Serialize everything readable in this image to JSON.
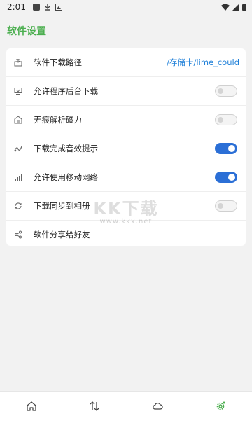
{
  "status_bar": {
    "time": "2:01"
  },
  "header": {
    "title": "软件设置"
  },
  "settings": [
    {
      "label": "软件下载路径",
      "icon": "download-folder-icon",
      "value": "/存储卡/lime_could"
    },
    {
      "label": "允许程序后台下载",
      "icon": "background-download-icon",
      "toggle": false
    },
    {
      "label": "无痕解析磁力",
      "icon": "magnet-parse-icon",
      "toggle": false
    },
    {
      "label": "下载完成音效提示",
      "icon": "sound-icon",
      "toggle": true
    },
    {
      "label": "允许使用移动网络",
      "icon": "mobile-signal-icon",
      "toggle": true
    },
    {
      "label": "下载同步到相册",
      "icon": "sync-icon",
      "toggle": false
    },
    {
      "label": "软件分享给好友",
      "icon": "share-icon"
    }
  ],
  "watermark": {
    "text": "KK下载",
    "url": "www.kkx.net"
  },
  "bottom_nav": [
    {
      "icon": "home-icon",
      "active": false
    },
    {
      "icon": "transfer-icon",
      "active": false
    },
    {
      "icon": "cloud-icon",
      "active": false
    },
    {
      "icon": "settings-gear-icon",
      "active": true
    }
  ],
  "colors": {
    "accent_green": "#4caf50",
    "toggle_on_blue": "#2b6fd6",
    "link_blue": "#1e7fd8"
  }
}
